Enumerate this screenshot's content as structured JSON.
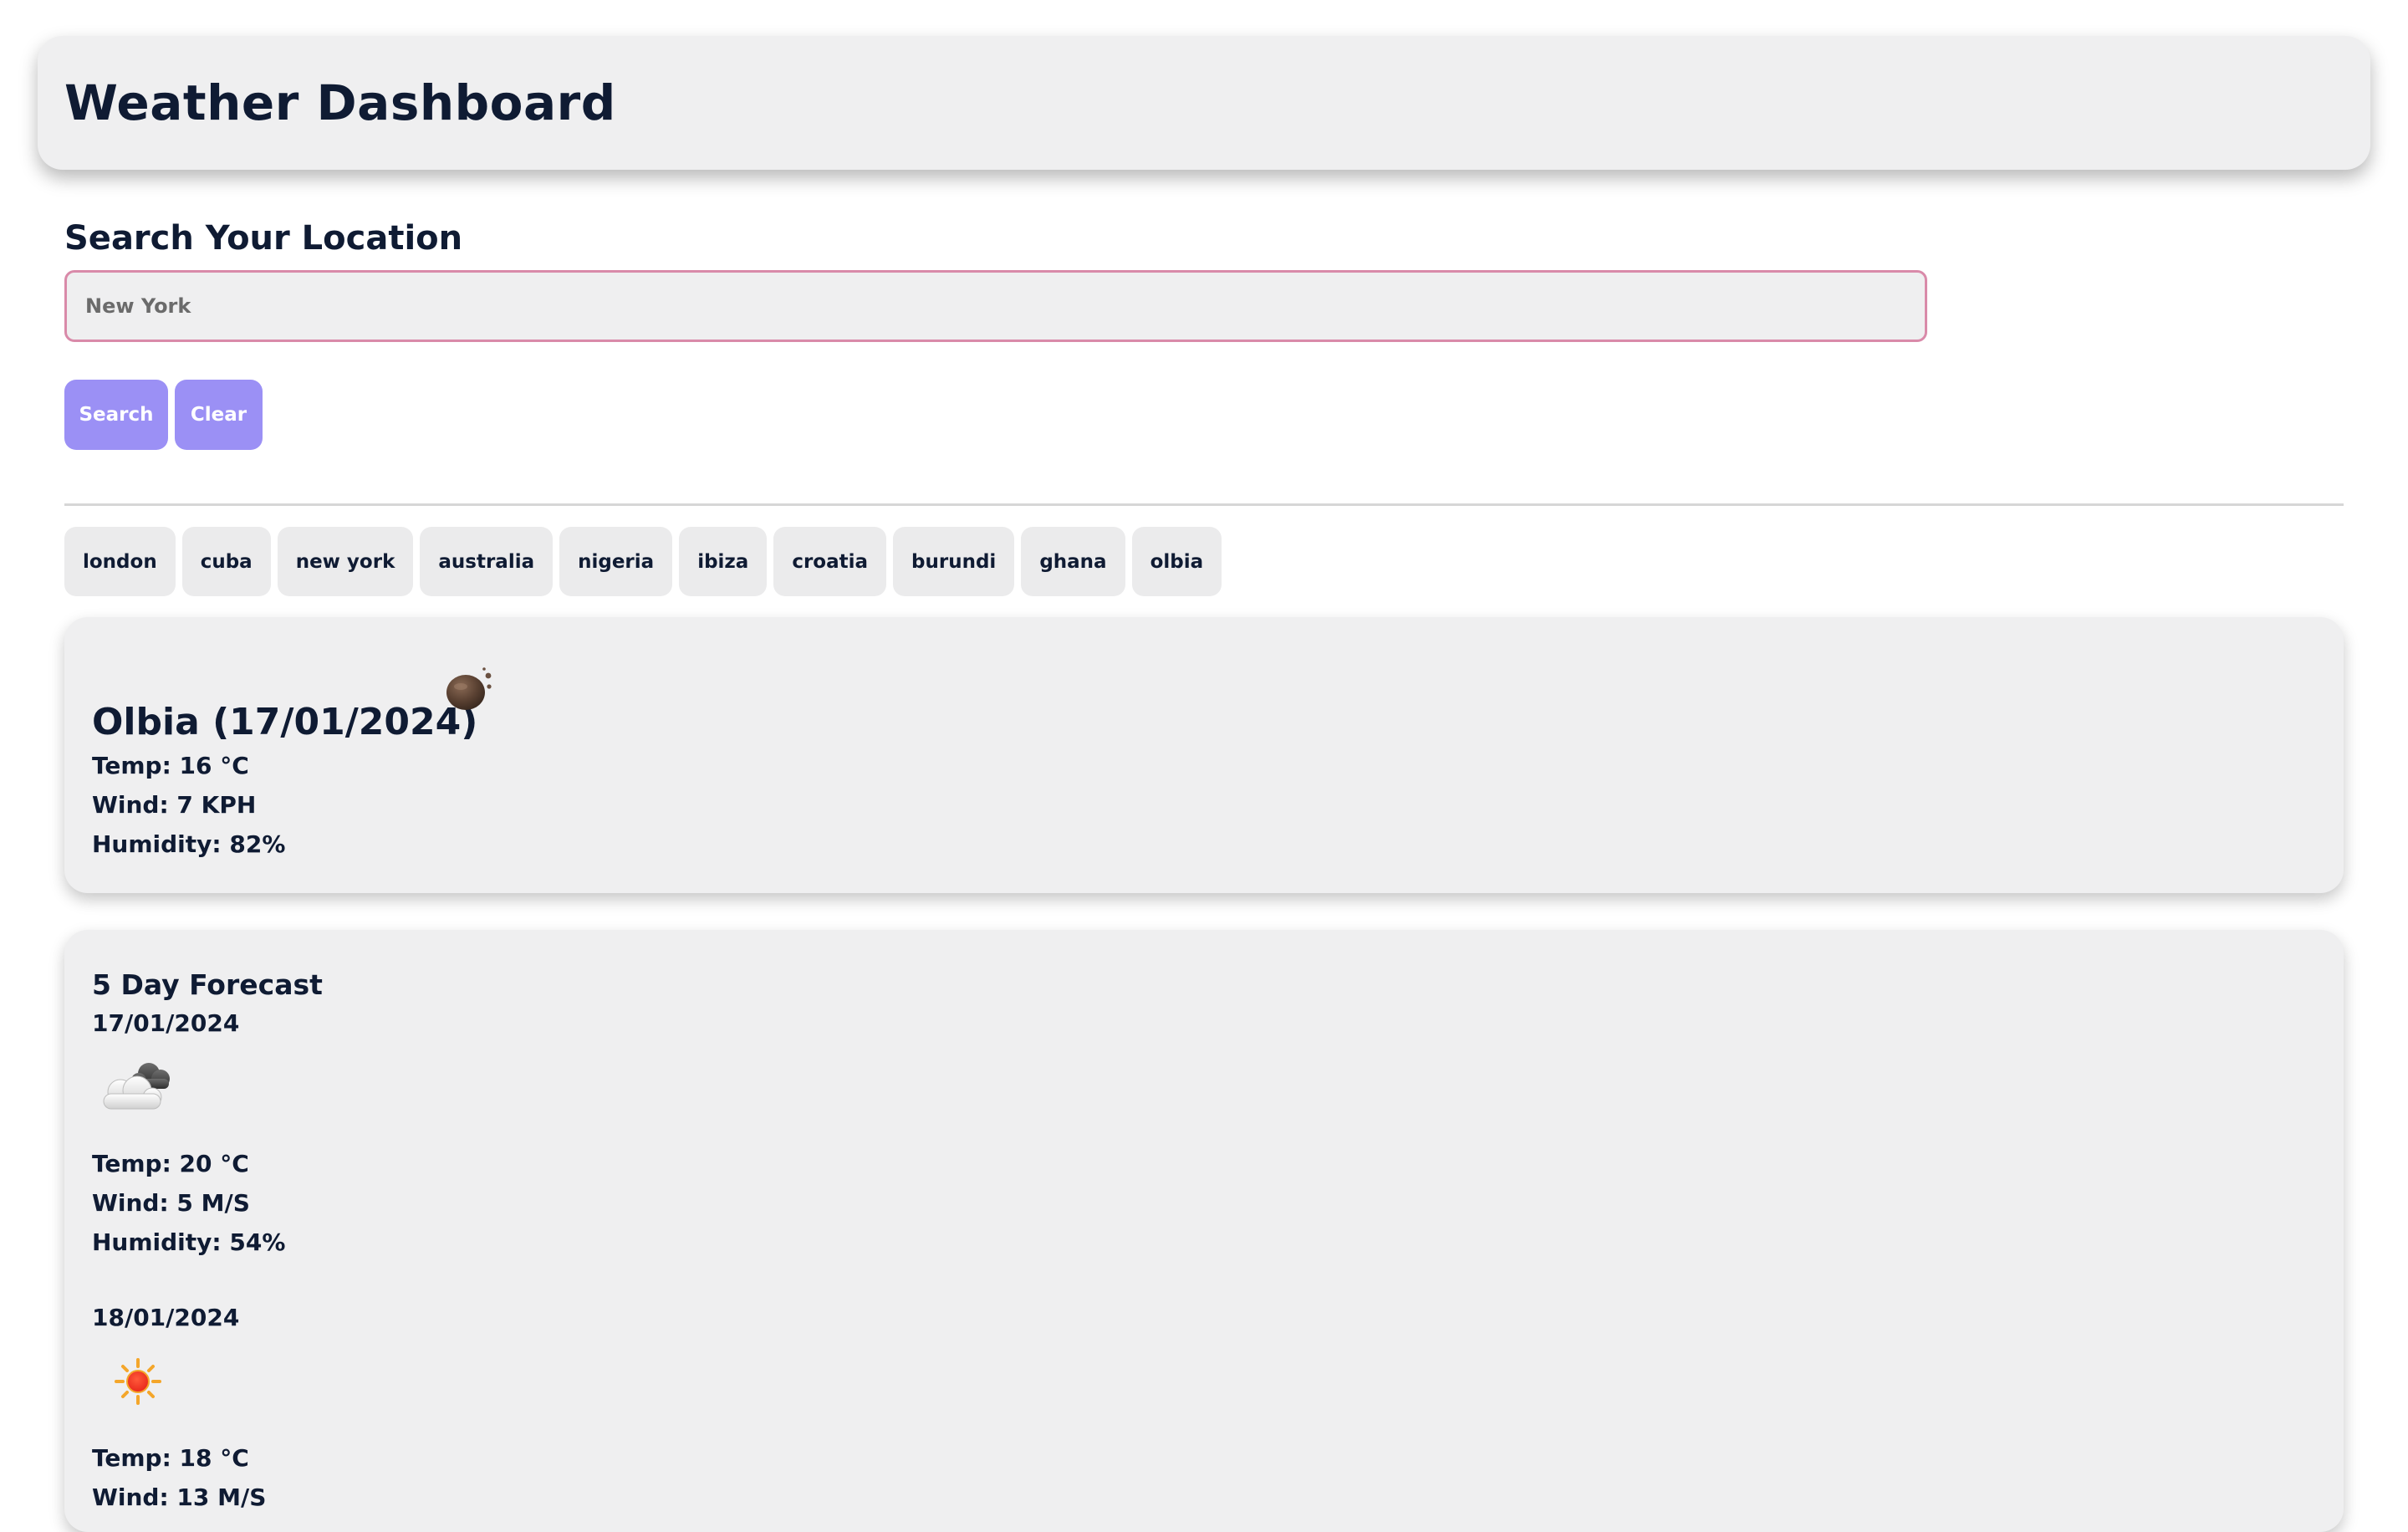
{
  "header": {
    "title": "Weather Dashboard"
  },
  "search": {
    "label": "Search Your Location",
    "placeholder": "New York",
    "value": "",
    "search_button": "Search",
    "clear_button": "Clear"
  },
  "history": [
    "london",
    "cuba",
    "new york",
    "australia",
    "nigeria",
    "ibiza",
    "croatia",
    "burundi",
    "ghana",
    "olbia"
  ],
  "current": {
    "title": "Olbia (17/01/2024)",
    "icon": "moon-icon",
    "temp": "Temp: 16 °C",
    "wind": "Wind: 7 KPH",
    "humidity": "Humidity: 82%"
  },
  "forecast": {
    "title": "5 Day Forecast",
    "days": [
      {
        "date": "17/01/2024",
        "icon": "cloud-icon",
        "temp": "Temp: 20 °C",
        "wind": "Wind: 5 M/S",
        "humidity": "Humidity: 54%"
      },
      {
        "date": "18/01/2024",
        "icon": "sun-icon",
        "temp": "Temp: 18 °C",
        "wind": "Wind: 13 M/S",
        "humidity": ""
      }
    ]
  },
  "colors": {
    "accent": "#9b90f5",
    "input_border": "#d98aa9",
    "card_bg": "#efeff0",
    "text": "#0f1b33"
  }
}
